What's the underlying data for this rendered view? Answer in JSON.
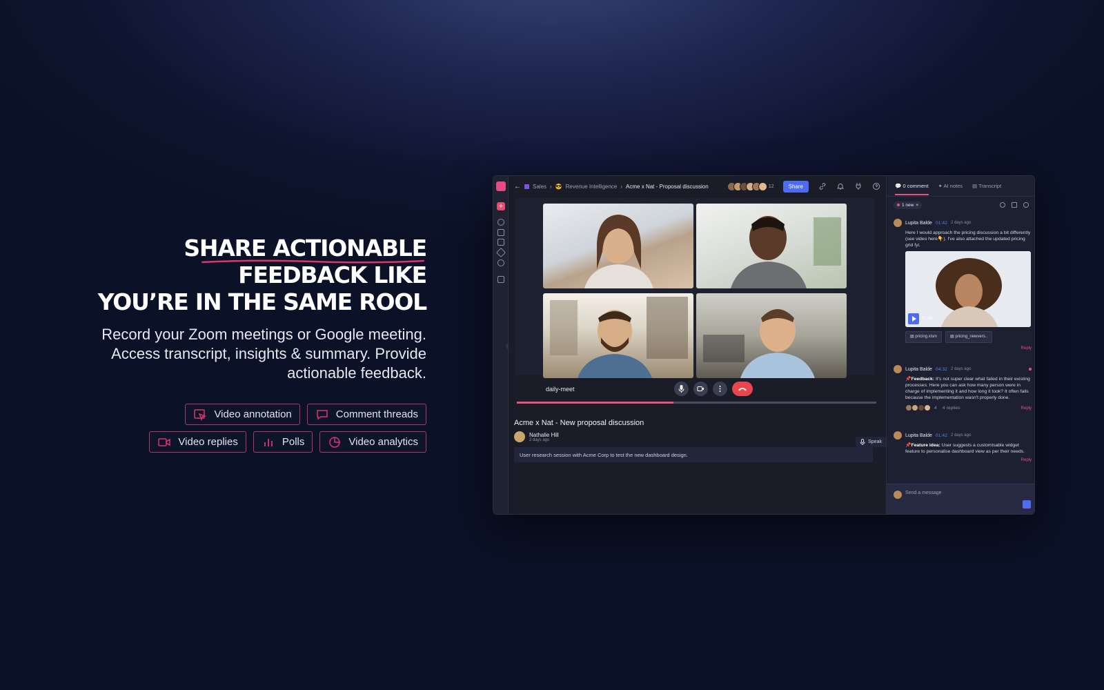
{
  "hero": {
    "headline_pre": "S",
    "headline_underlined": "HARE ACTIONABLE",
    "headline_line2": "FEEDBACK LIKE",
    "headline_line3": "YOU’RE IN THE SAME ROOL",
    "subtitle": "Record your Zoom meetings or Google meeting. Access transcript, insights & summary. Provide actionable feedback.",
    "features": [
      {
        "label": "Video annotation",
        "icon": "cursor-select-icon"
      },
      {
        "label": "Comment threads",
        "icon": "chat-bubble-icon"
      },
      {
        "label": "Video replies",
        "icon": "video-camera-icon"
      },
      {
        "label": "Polls",
        "icon": "bar-chart-icon"
      },
      {
        "label": "Video analytics",
        "icon": "pie-chart-icon"
      }
    ],
    "accent": "#b03866"
  },
  "app": {
    "breadcrumb": {
      "b1": "Sales",
      "b2": "Revenue Intelligence",
      "current": "Acme x Nat - Proposal discussion"
    },
    "participant_count": "12",
    "share_label": "Share",
    "meet_name": "daily-meet",
    "meeting_title": "Acme x Nat - New proposal discussion",
    "author": {
      "name": "Nathalie Hill",
      "time": "2 days ago"
    },
    "speak_label": "Speak",
    "description": "User research session with Acme Corp to test the new dashboard design.",
    "progress": 0.435,
    "colors": {
      "primary": "#4e6cf0",
      "accent": "#e8547a",
      "end_call": "#e8454d"
    }
  },
  "panel": {
    "tabs": [
      "0 comment",
      "AI notes",
      "Transcript"
    ],
    "new_tag": "1 new",
    "comments": [
      {
        "name": "Lupita Balde",
        "ts": "01:42",
        "ago": "2 days ago",
        "text": "Here I would approach the pricing discussion a bit differently (see video here👇). I've also attached the updated pricing grid fyi.",
        "video_duration": "01:56",
        "files": [
          "pricing.xlsm",
          "pricing_newvers.."
        ],
        "reply": "Reply"
      },
      {
        "name": "Lupita Balde",
        "ts": "04:32",
        "ago": "2 days ago",
        "label": "Feedback:",
        "text": "It's not super clear what failed in their existing processes. Here you can ask how many person were in charge of implementing it and how long it took? It often fails because the implementation wasn't properly done.",
        "reactions": "4",
        "replies": "4 replies",
        "reply": "Reply"
      },
      {
        "name": "Lupita Balde",
        "ts": "01:42",
        "ago": "2 days ago",
        "label": "Feature idea:",
        "text": "User suggests a customisable widget feature to personalise dashboard view as per their needs.",
        "reply": "Reply"
      }
    ],
    "message_placeholder": "Send a message"
  }
}
